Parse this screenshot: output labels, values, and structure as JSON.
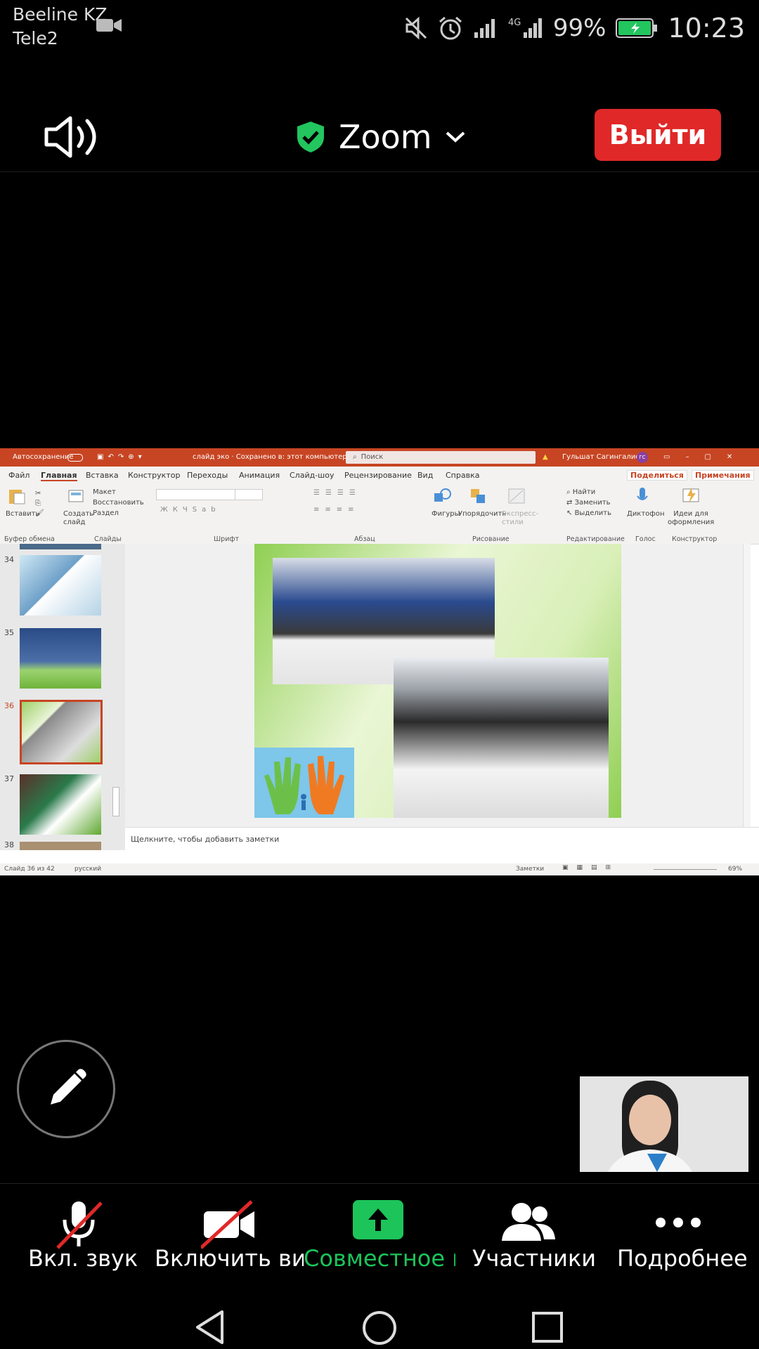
{
  "status": {
    "carrier1": "Beeline KZ",
    "carrier2": "Tele2",
    "battery": "99%",
    "time": "10:23"
  },
  "topbar": {
    "title": "Zoom",
    "leave": "Выйти"
  },
  "ppt": {
    "autosave": "Автосохранение",
    "doc": "слайд эко · Сохранено в: этот компьютер ⌄",
    "search": "Поиск",
    "user": "Гульшат Сагингалиева",
    "initials": "ГС",
    "menu": [
      "Файл",
      "Главная",
      "Вставка",
      "Конструктор",
      "Переходы",
      "Анимация",
      "Слайд-шоу",
      "Рецензирование",
      "Вид",
      "Справка"
    ],
    "share": "Поделиться",
    "comments": "Примечания",
    "groups": [
      "Буфер обмена",
      "Слайды",
      "Шрифт",
      "Абзац",
      "Рисование",
      "Редактирование",
      "Голос",
      "Конструктор"
    ],
    "buttons": {
      "paste": "Вставить",
      "newslide": "Создать слайд",
      "layout": "Макет",
      "reset": "Восстановить",
      "section": "Раздел",
      "shapes": "Фигуры",
      "arrange": "Упорядочить",
      "quickstyles": "Экспресс-стили",
      "find": "Найти",
      "replace": "Заменить",
      "select": "Выделить",
      "dictate": "Диктофон",
      "ideas": "Идеи для оформления"
    },
    "thumb_nums": [
      "34",
      "35",
      "36",
      "37",
      "38"
    ],
    "notes": "Щелкните, чтобы добавить заметки",
    "status_slide": "Слайд 36 из 42",
    "status_lang": "русский",
    "status_notes": "Заметки",
    "zoom": "69%"
  },
  "toolbar": {
    "audio": "Вкл. звук",
    "video": "Включить вид",
    "share": "Совместное и",
    "participants": "Участники",
    "more": "Подробнее"
  },
  "colors": {
    "leave": "#e02828",
    "share_green": "#1cc45a",
    "ppt_red": "#c74523",
    "shield": "#22c55e"
  }
}
